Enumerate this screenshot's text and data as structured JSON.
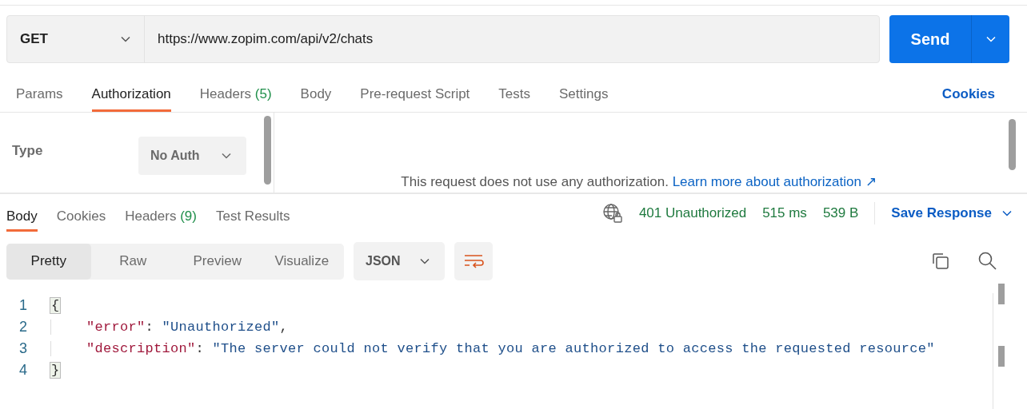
{
  "request": {
    "method": "GET",
    "url": "https://www.zopim.com/api/v2/chats",
    "send": "Send"
  },
  "request_tabs": [
    {
      "label": "Params",
      "selected": false
    },
    {
      "label": "Authorization",
      "selected": true
    },
    {
      "label": "Headers",
      "count": "(5)",
      "selected": false
    },
    {
      "label": "Body",
      "selected": false
    },
    {
      "label": "Pre-request Script",
      "selected": false
    },
    {
      "label": "Tests",
      "selected": false
    },
    {
      "label": "Settings",
      "selected": false
    }
  ],
  "cookies_link": "Cookies",
  "auth": {
    "type_label": "Type",
    "type_value": "No Auth",
    "message": "This request does not use any authorization.",
    "link": "Learn more about authorization ↗"
  },
  "response_tabs": [
    {
      "label": "Body",
      "selected": true
    },
    {
      "label": "Cookies",
      "selected": false
    },
    {
      "label": "Headers",
      "count": "(9)",
      "selected": false
    },
    {
      "label": "Test Results",
      "selected": false
    }
  ],
  "response_status": {
    "status": "401 Unauthorized",
    "time": "515 ms",
    "size": "539 B",
    "save": "Save Response"
  },
  "view_modes": [
    {
      "label": "Pretty",
      "selected": true
    },
    {
      "label": "Raw",
      "selected": false
    },
    {
      "label": "Preview",
      "selected": false
    },
    {
      "label": "Visualize",
      "selected": false
    }
  ],
  "format": "JSON",
  "code_lines": [
    {
      "number": "1",
      "indent": false,
      "tokens": [
        {
          "kind": "bracket",
          "text": "{"
        }
      ]
    },
    {
      "number": "2",
      "indent": true,
      "tokens": [
        {
          "kind": "key",
          "text": "\"error\""
        },
        {
          "kind": "punct",
          "text": ": "
        },
        {
          "kind": "string",
          "text": "\"Unauthorized\""
        },
        {
          "kind": "punct",
          "text": ","
        }
      ]
    },
    {
      "number": "3",
      "indent": true,
      "tokens": [
        {
          "kind": "key",
          "text": "\"description\""
        },
        {
          "kind": "punct",
          "text": ": "
        },
        {
          "kind": "string",
          "text": "\"The server could not verify that you are authorized to access the requested resource\""
        }
      ]
    },
    {
      "number": "4",
      "indent": false,
      "tokens": [
        {
          "kind": "bracket",
          "text": "}"
        }
      ]
    }
  ]
}
